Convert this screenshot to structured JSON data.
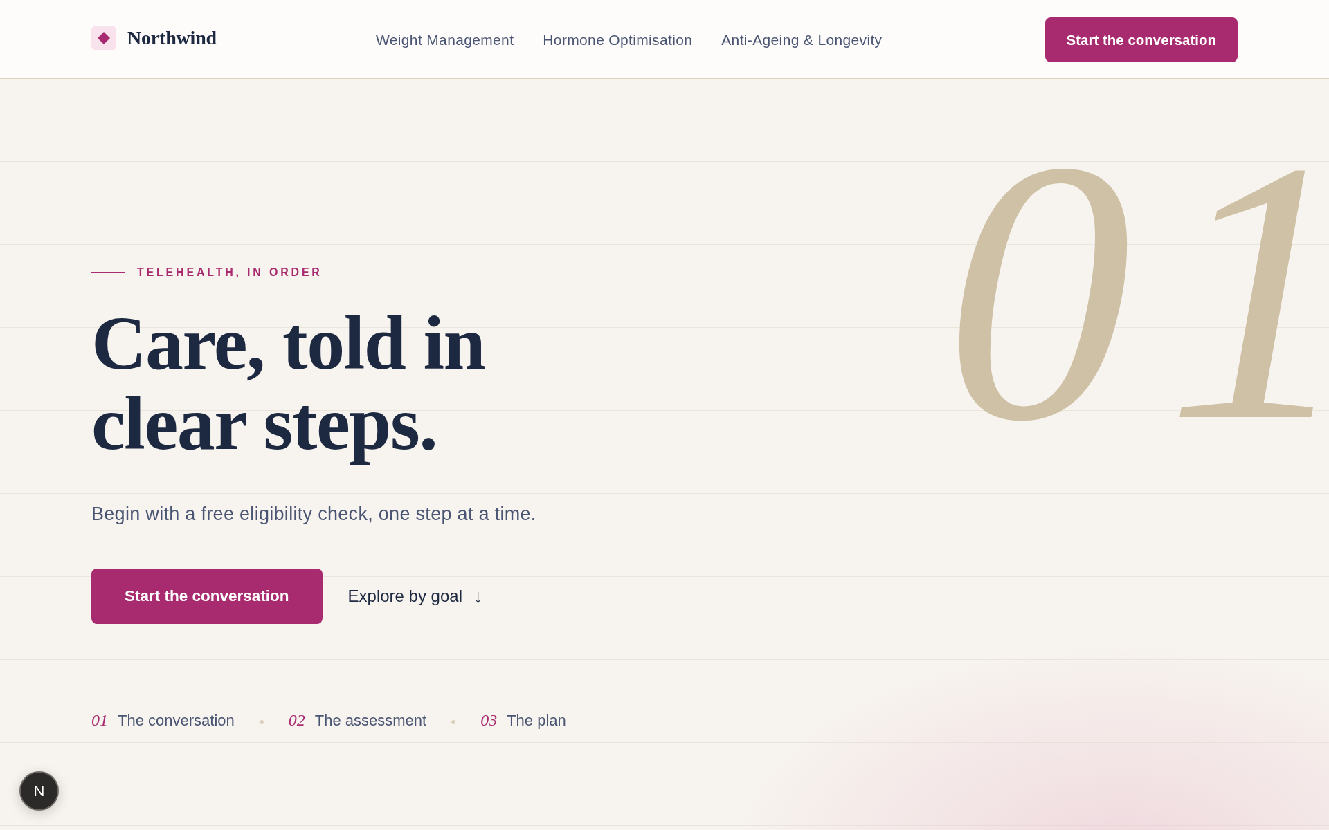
{
  "header": {
    "brand": "Northwind",
    "nav": [
      {
        "label": "Weight Management"
      },
      {
        "label": "Hormone Optimisation"
      },
      {
        "label": "Anti-Ageing & Longevity"
      }
    ],
    "cta": "Start the conversation"
  },
  "hero": {
    "eyebrow": "TELEHEALTH, IN ORDER",
    "headline_lines": [
      "Care, told in",
      "clear steps."
    ],
    "subtitle": "Begin with a free eligibility check, one step at a time.",
    "primary_button": "Start the conversation",
    "secondary_link": {
      "label": "Explore by goal",
      "arrow": "↓"
    },
    "step_numeral": "01",
    "steps": [
      {
        "number": "01",
        "label": "The conversation"
      },
      {
        "number": "02",
        "label": "The assessment"
      },
      {
        "number": "03",
        "label": "The plan"
      }
    ]
  },
  "devtools_badge": {
    "label": "N"
  }
}
